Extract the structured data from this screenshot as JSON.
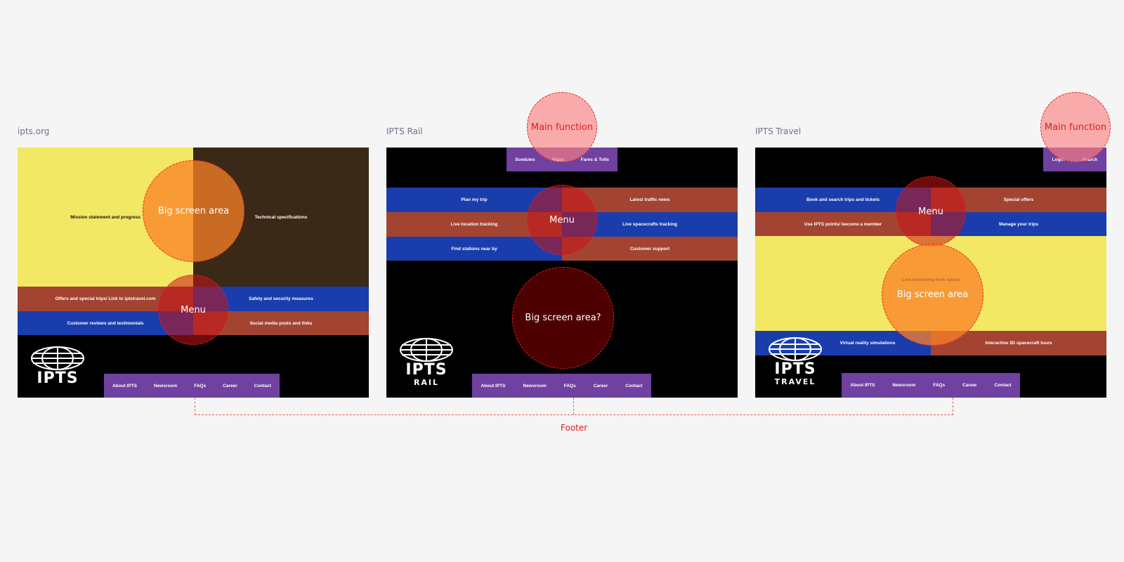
{
  "panels": [
    {
      "title": "ipts.org",
      "hero": {
        "left": "Mission statement and progress",
        "right": "Technical specifications"
      },
      "menu_rows": [
        {
          "left": "Offers and special trips/ Link to iptstravel.com",
          "right": "Safety and security measures"
        },
        {
          "left": "Customer reviews and testimonials",
          "right": "Social media posts and links"
        }
      ],
      "logo": {
        "text": "IPTS",
        "sub": ""
      },
      "annotations": {
        "big_screen": "Big screen area",
        "menu": "Menu"
      }
    },
    {
      "title": "IPTS Rail",
      "top_nav": [
        "Scedules",
        "Maps",
        "Fares & Tolls"
      ],
      "menu_rows": [
        {
          "left": "Plan my trip",
          "right": "Latest traffic news"
        },
        {
          "left": "Live location tracking",
          "right": "Live spacecrafts tracking"
        },
        {
          "left": "Find stations near by",
          "right": "Customer support"
        }
      ],
      "logo": {
        "text": "IPTS",
        "sub": "RAIL"
      },
      "annotations": {
        "main_function": "Main function",
        "menu": "Menu",
        "big_screen": "Big screen area?"
      }
    },
    {
      "title": "IPTS Travel",
      "top_nav": [
        "Login",
        "Search"
      ],
      "menu_rows": [
        {
          "left": "Book and search trips and tickets",
          "right": "Special offers"
        },
        {
          "left": "Use IPTS points/ become a member",
          "right": "Manage your trips"
        }
      ],
      "hero": {
        "center": "Live streaming from space"
      },
      "bottom_row": {
        "left": "Virtual reality simulations",
        "right": "Interactive 3D spacecraft tours"
      },
      "logo": {
        "text": "IPTS",
        "sub": "TRAVEL"
      },
      "annotations": {
        "main_function": "Main function",
        "menu": "Menu",
        "big_screen": "Big screen area"
      }
    }
  ],
  "footer_nav": [
    "About IPTS",
    "Newsroom",
    "FAQs",
    "Career",
    "Contact"
  ],
  "footer_annotation": "Footer"
}
